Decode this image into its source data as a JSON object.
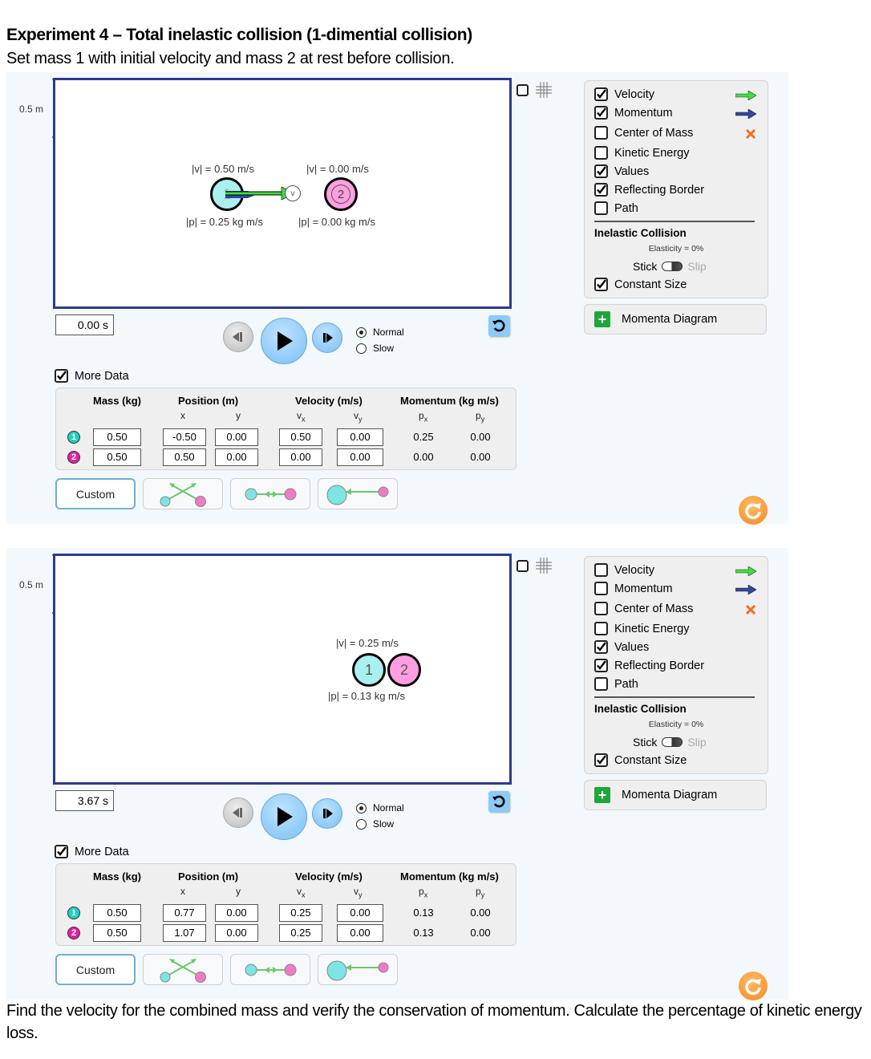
{
  "document": {
    "title": "Experiment 4 – Total inelastic collision (1-dimential collision)",
    "subtitle": "Set mass 1 with initial velocity and mass 2 at rest before collision.",
    "question": "Find the velocity for the combined mass and verify the conservation of momentum. Calculate the percentage of kinetic energy loss."
  },
  "colors": {
    "border": "#2e3a8c",
    "ball1": "#aaf0ee",
    "ball2": "#ff9ee0",
    "velocity_arrow": "#3de03d",
    "momentum_arrow": "#3344a0",
    "center_of_mass": "#f07020",
    "reset_orange": "#f08a20",
    "play_blue": "#7cc0f5"
  },
  "sims": [
    {
      "scale_label": "0.5 m",
      "balls": [
        {
          "number": "1",
          "v_label": "|v| = 0.50 m/s",
          "p_label": "|p| = 0.25 kg m/s"
        },
        {
          "number": "2",
          "v_label": "|v| = 0.00 m/s",
          "p_label": "|p| = 0.00 kg m/s"
        }
      ],
      "grid_checked": false,
      "options": [
        {
          "label": "Velocity",
          "checked": true,
          "legend": "velocity-arrow"
        },
        {
          "label": "Momentum",
          "checked": true,
          "legend": "momentum-arrow"
        },
        {
          "label": "Center of Mass",
          "checked": false,
          "legend": "center-of-mass-x"
        },
        {
          "label": "Kinetic Energy",
          "checked": false
        },
        {
          "label": "Values",
          "checked": true
        },
        {
          "label": "Reflecting Border",
          "checked": true
        },
        {
          "label": "Path",
          "checked": false
        }
      ],
      "inelastic_title": "Inelastic Collision",
      "elasticity": "Elasticity = 0%",
      "stick_label": "Stick",
      "slip_label": "Slip",
      "constant_size": {
        "label": "Constant Size",
        "checked": true
      },
      "momenta_diagram": "Momenta Diagram",
      "time": "0.00 s",
      "speed": {
        "normal": "Normal",
        "slow": "Slow",
        "selected": "Normal"
      },
      "more_data": {
        "label": "More Data",
        "checked": true
      },
      "headers": {
        "mass": "Mass (kg)",
        "position": "Position (m)",
        "velocity": "Velocity (m/s)",
        "momentum": "Momentum (kg m/s)",
        "x": "x",
        "y": "y",
        "vx": "Vx",
        "vy": "Vy",
        "px": "Px",
        "py": "Py"
      },
      "rows": [
        {
          "id": "1",
          "mass": "0.50",
          "x": "-0.50",
          "y": "0.00",
          "vx": "0.50",
          "vy": "0.00",
          "px": "0.25",
          "py": "0.00"
        },
        {
          "id": "2",
          "mass": "0.50",
          "x": "0.50",
          "y": "0.00",
          "vx": "0.00",
          "vy": "0.00",
          "px": "0.00",
          "py": "0.00"
        }
      ],
      "preset_custom": "Custom"
    },
    {
      "scale_label": "0.5 m",
      "balls": [
        {
          "number": "1",
          "v_label": "|v| = 0.25 m/s",
          "p_label": "|p| = 0.13 kg m/s"
        },
        {
          "number": "2",
          "v_label": "|v| = 0.25 m/s",
          "p_label": "|p| = 0.13 kg m/s"
        }
      ],
      "grid_checked": false,
      "options": [
        {
          "label": "Velocity",
          "checked": false,
          "legend": "velocity-arrow"
        },
        {
          "label": "Momentum",
          "checked": false,
          "legend": "momentum-arrow"
        },
        {
          "label": "Center of Mass",
          "checked": false,
          "legend": "center-of-mass-x"
        },
        {
          "label": "Kinetic Energy",
          "checked": false
        },
        {
          "label": "Values",
          "checked": true
        },
        {
          "label": "Reflecting Border",
          "checked": true
        },
        {
          "label": "Path",
          "checked": false
        }
      ],
      "inelastic_title": "Inelastic Collision",
      "elasticity": "Elasticity = 0%",
      "stick_label": "Stick",
      "slip_label": "Slip",
      "constant_size": {
        "label": "Constant Size",
        "checked": true
      },
      "momenta_diagram": "Momenta Diagram",
      "time": "3.67 s",
      "speed": {
        "normal": "Normal",
        "slow": "Slow",
        "selected": "Normal"
      },
      "more_data": {
        "label": "More Data",
        "checked": true
      },
      "headers": {
        "mass": "Mass (kg)",
        "position": "Position (m)",
        "velocity": "Velocity (m/s)",
        "momentum": "Momentum (kg m/s)",
        "x": "x",
        "y": "y",
        "vx": "Vx",
        "vy": "Vy",
        "px": "Px",
        "py": "Py"
      },
      "rows": [
        {
          "id": "1",
          "mass": "0.50",
          "x": "0.77",
          "y": "0.00",
          "vx": "0.25",
          "vy": "0.00",
          "px": "0.13",
          "py": "0.00"
        },
        {
          "id": "2",
          "mass": "0.50",
          "x": "1.07",
          "y": "0.00",
          "vx": "0.25",
          "vy": "0.00",
          "px": "0.13",
          "py": "0.00"
        }
      ],
      "preset_custom": "Custom"
    }
  ]
}
